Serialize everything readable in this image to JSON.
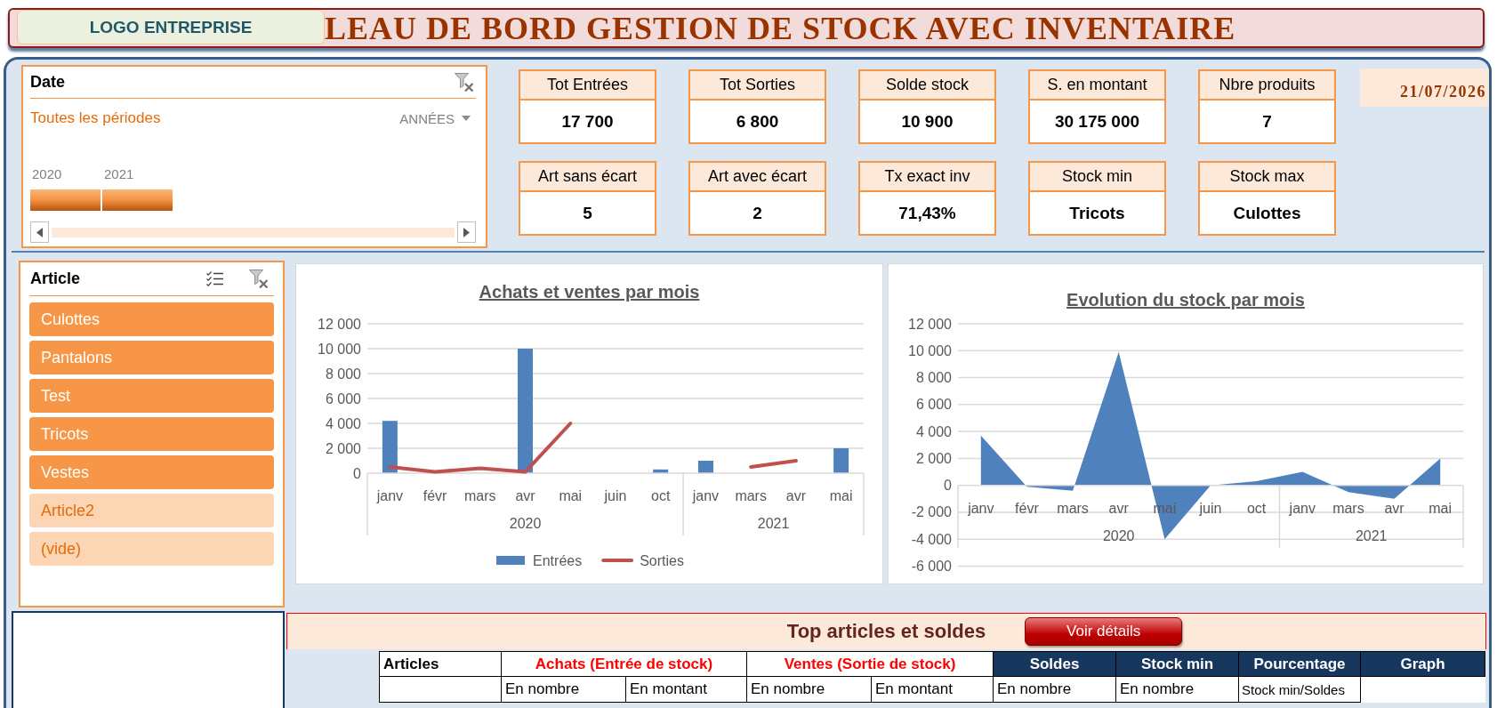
{
  "header": {
    "logo": "LOGO ENTREPRISE",
    "title": "LEAU DE BORD GESTION DE STOCK AVEC INVENTAIRE"
  },
  "date_slicer": {
    "title": "Date",
    "selection": "Toutes les périodes",
    "period_unit": "ANNÉES",
    "periods": [
      {
        "label": "2020",
        "selected": true
      },
      {
        "label": "2021",
        "selected": true
      }
    ]
  },
  "kpis": [
    {
      "label": "Tot Entrées",
      "value": "17 700"
    },
    {
      "label": "Tot Sorties",
      "value": "6 800"
    },
    {
      "label": "Solde stock",
      "value": "10 900"
    },
    {
      "label": "S. en montant",
      "value": "30 175 000"
    },
    {
      "label": "Nbre produits",
      "value": "7"
    },
    {
      "label": "Art sans écart",
      "value": "5"
    },
    {
      "label": "Art avec écart",
      "value": "2"
    },
    {
      "label": "Tx exact inv",
      "value": "71,43%"
    },
    {
      "label": "Stock min",
      "value": "Tricots"
    },
    {
      "label": "Stock max",
      "value": "Culottes"
    }
  ],
  "current_date": "21/07/2026",
  "article_slicer": {
    "title": "Article",
    "items": [
      {
        "label": "Culottes",
        "selected": true
      },
      {
        "label": "Pantalons",
        "selected": true
      },
      {
        "label": "Test",
        "selected": true
      },
      {
        "label": "Tricots",
        "selected": true
      },
      {
        "label": "Vestes",
        "selected": true
      },
      {
        "label": "Article2",
        "selected": false
      },
      {
        "label": "(vide)",
        "selected": false
      }
    ]
  },
  "charts": [
    {
      "chart_data": {
        "type": "bar",
        "title": "Achats et ventes par mois",
        "categories": [
          "janv",
          "févr",
          "mars",
          "avr",
          "mai",
          "juin",
          "oct",
          "janv",
          "mars",
          "avr",
          "mai"
        ],
        "annotations": [
          "2020",
          "2021"
        ],
        "series": [
          {
            "name": "Entrées",
            "color": "#4f81bd",
            "values": [
              4200,
              null,
              null,
              10000,
              null,
              null,
              300,
              1000,
              null,
              null,
              2000
            ]
          },
          {
            "name": "Sorties",
            "type": "line",
            "color": "#c0504d",
            "values": [
              500,
              100,
              400,
              100,
              4000,
              null,
              null,
              null,
              500,
              1000,
              null
            ]
          }
        ],
        "ylim": [
          0,
          12000
        ],
        "yticks": [
          0,
          {
            "value": 2000,
            "label": "2 000"
          },
          {
            "value": 4000,
            "label": "4 000"
          },
          {
            "value": 6000,
            "label": "6 000"
          },
          {
            "value": 8000,
            "label": "8 000"
          },
          {
            "value": 10000,
            "label": "10 000"
          },
          {
            "value": 12000,
            "label": "12 000"
          }
        ],
        "grid": true,
        "legend": "bottom"
      }
    },
    {
      "chart_data": {
        "type": "area",
        "title": "Evolution du stock par mois",
        "categories": [
          "janv",
          "févr",
          "mars",
          "avr",
          "mai",
          "juin",
          "oct",
          "janv",
          "mars",
          "avr",
          "mai"
        ],
        "annotations": [
          "2020",
          "2021"
        ],
        "series": [
          {
            "color": "#4f81bd",
            "values": [
              3700,
              -100,
              -400,
              9900,
              -4000,
              0,
              300,
              1000,
              -500,
              -1000,
              2000
            ]
          }
        ],
        "ylim": [
          -6000,
          12000
        ],
        "yticks": [
          {
            "value": -6000,
            "label": "-6 000"
          },
          {
            "value": -4000,
            "label": "-4 000"
          },
          {
            "value": -2000,
            "label": "-2 000"
          },
          0,
          {
            "value": 2000,
            "label": "2 000"
          },
          {
            "value": 4000,
            "label": "4 000"
          },
          {
            "value": 6000,
            "label": "6 000"
          },
          {
            "value": 8000,
            "label": "8 000"
          },
          {
            "value": 10000,
            "label": "10 000"
          },
          {
            "value": 12000,
            "label": "12 000"
          }
        ],
        "grid": true
      }
    }
  ],
  "top_articles": {
    "title": "Top articles et soldes",
    "button": "Voir détails",
    "columns": [
      {
        "label": "Articles",
        "kind": "plain"
      },
      {
        "label": "Achats (Entrée de stock)",
        "kind": "group"
      },
      {
        "label": "Ventes (Sortie de stock)",
        "kind": "group"
      },
      {
        "label": "Soldes",
        "kind": "dark"
      },
      {
        "label": "Stock min",
        "kind": "dark"
      },
      {
        "label": "Pourcentage",
        "kind": "dark"
      },
      {
        "label": "Graph",
        "kind": "dark"
      }
    ],
    "subheaders": [
      "En nombre",
      "En montant",
      "En nombre",
      "En montant",
      "En nombre",
      "En nombre",
      "Stock min/Soldes"
    ]
  }
}
